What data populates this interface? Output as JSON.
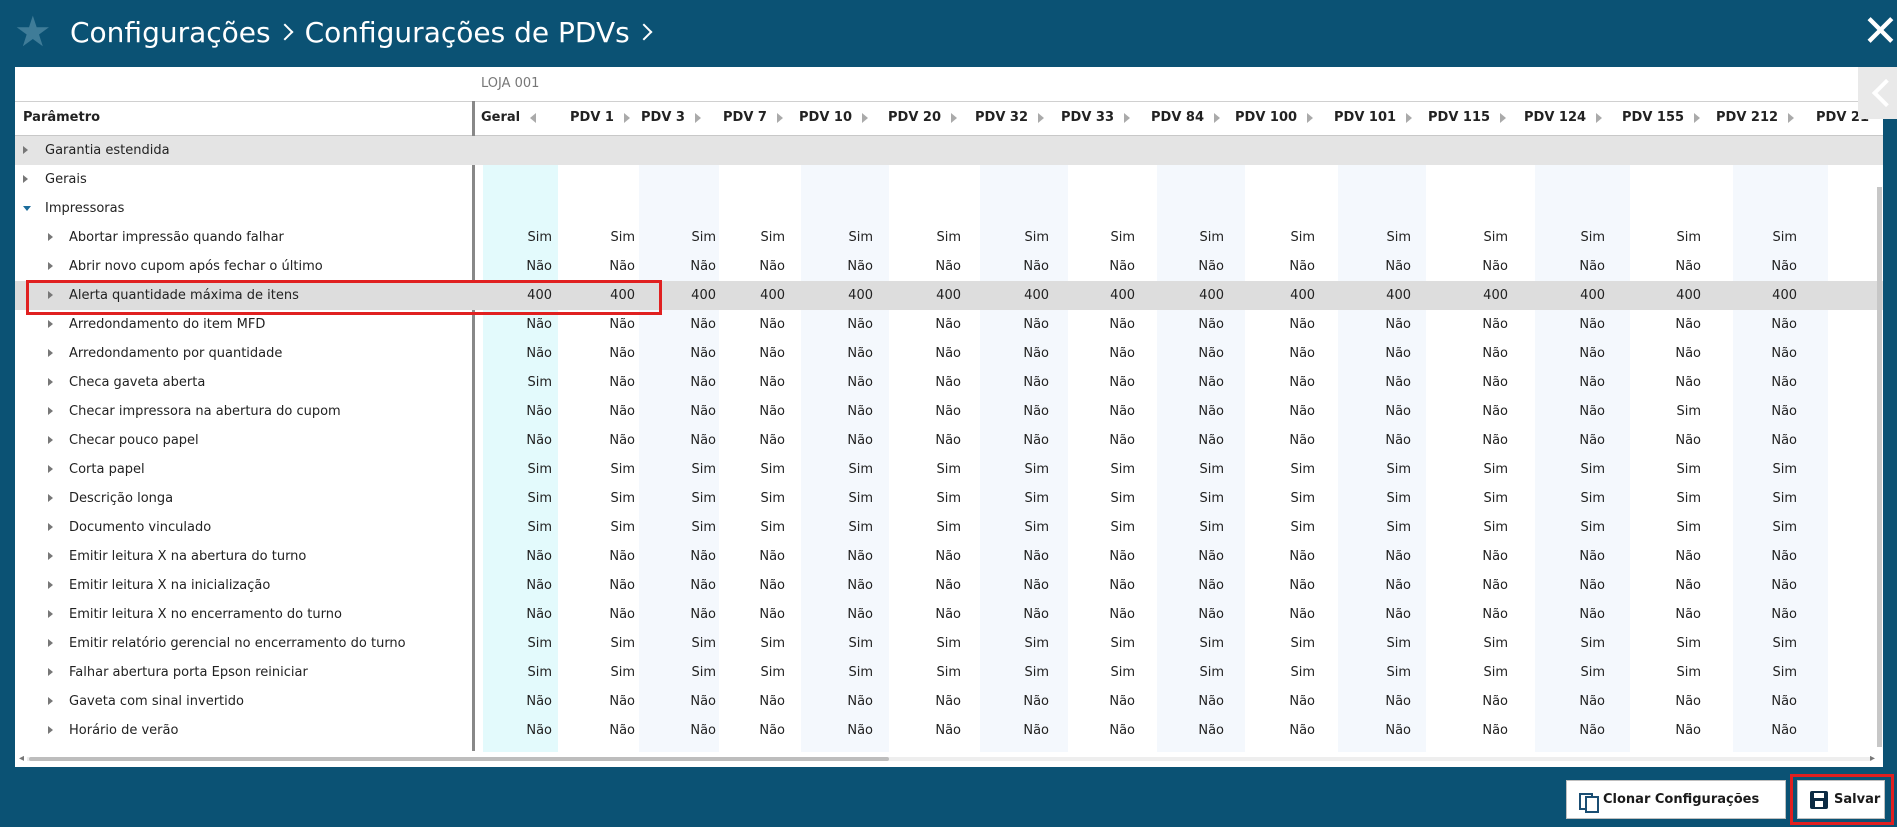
{
  "header": {
    "breadcrumbs": [
      "Configurações",
      "Configurações de PDVs"
    ]
  },
  "table": {
    "store_label": "LOJA 001",
    "param_header": "Parâmetro",
    "columns": [
      "Geral",
      "PDV 1",
      "PDV 3",
      "PDV 7",
      "PDV 10",
      "PDV 20",
      "PDV 32",
      "PDV 33",
      "PDV 84",
      "PDV 100",
      "PDV 101",
      "PDV 115",
      "PDV 124",
      "PDV 155",
      "PDV 212",
      "PDV 21"
    ],
    "groups": [
      {
        "label": "Garantia estendida"
      },
      {
        "label": "Gerais"
      },
      {
        "label": "Impressoras"
      }
    ],
    "rows": [
      {
        "label": "Abortar impressão quando falhar",
        "values": [
          "Sim",
          "Sim",
          "Sim",
          "Sim",
          "Sim",
          "Sim",
          "Sim",
          "Sim",
          "Sim",
          "Sim",
          "Sim",
          "Sim",
          "Sim",
          "Sim",
          "Sim"
        ]
      },
      {
        "label": "Abrir novo cupom após fechar o último",
        "values": [
          "Não",
          "Não",
          "Não",
          "Não",
          "Não",
          "Não",
          "Não",
          "Não",
          "Não",
          "Não",
          "Não",
          "Não",
          "Não",
          "Não",
          "Não"
        ]
      },
      {
        "label": "Alerta quantidade máxima de itens",
        "values": [
          "400",
          "400",
          "400",
          "400",
          "400",
          "400",
          "400",
          "400",
          "400",
          "400",
          "400",
          "400",
          "400",
          "400",
          "400"
        ]
      },
      {
        "label": "Arredondamento do item MFD",
        "values": [
          "Não",
          "Não",
          "Não",
          "Não",
          "Não",
          "Não",
          "Não",
          "Não",
          "Não",
          "Não",
          "Não",
          "Não",
          "Não",
          "Não",
          "Não"
        ]
      },
      {
        "label": "Arredondamento por quantidade",
        "values": [
          "Não",
          "Não",
          "Não",
          "Não",
          "Não",
          "Não",
          "Não",
          "Não",
          "Não",
          "Não",
          "Não",
          "Não",
          "Não",
          "Não",
          "Não"
        ]
      },
      {
        "label": "Checa gaveta aberta",
        "values": [
          "Sim",
          "Não",
          "Não",
          "Não",
          "Não",
          "Não",
          "Não",
          "Não",
          "Não",
          "Não",
          "Não",
          "Não",
          "Não",
          "Não",
          "Não"
        ]
      },
      {
        "label": "Checar impressora na abertura do cupom",
        "values": [
          "Não",
          "Não",
          "Não",
          "Não",
          "Não",
          "Não",
          "Não",
          "Não",
          "Não",
          "Não",
          "Não",
          "Não",
          "Não",
          "Sim",
          "Não"
        ]
      },
      {
        "label": "Checar pouco papel",
        "values": [
          "Não",
          "Não",
          "Não",
          "Não",
          "Não",
          "Não",
          "Não",
          "Não",
          "Não",
          "Não",
          "Não",
          "Não",
          "Não",
          "Não",
          "Não"
        ]
      },
      {
        "label": "Corta papel",
        "values": [
          "Sim",
          "Sim",
          "Sim",
          "Sim",
          "Sim",
          "Sim",
          "Sim",
          "Sim",
          "Sim",
          "Sim",
          "Sim",
          "Sim",
          "Sim",
          "Sim",
          "Sim"
        ]
      },
      {
        "label": "Descrição longa",
        "values": [
          "Sim",
          "Sim",
          "Sim",
          "Sim",
          "Sim",
          "Sim",
          "Sim",
          "Sim",
          "Sim",
          "Sim",
          "Sim",
          "Sim",
          "Sim",
          "Sim",
          "Sim"
        ]
      },
      {
        "label": "Documento vinculado",
        "values": [
          "Sim",
          "Sim",
          "Sim",
          "Sim",
          "Sim",
          "Sim",
          "Sim",
          "Sim",
          "Sim",
          "Sim",
          "Sim",
          "Sim",
          "Sim",
          "Sim",
          "Sim"
        ]
      },
      {
        "label": "Emitir leitura X na abertura do turno",
        "values": [
          "Não",
          "Não",
          "Não",
          "Não",
          "Não",
          "Não",
          "Não",
          "Não",
          "Não",
          "Não",
          "Não",
          "Não",
          "Não",
          "Não",
          "Não"
        ]
      },
      {
        "label": "Emitir leitura X na inicialização",
        "values": [
          "Não",
          "Não",
          "Não",
          "Não",
          "Não",
          "Não",
          "Não",
          "Não",
          "Não",
          "Não",
          "Não",
          "Não",
          "Não",
          "Não",
          "Não"
        ]
      },
      {
        "label": "Emitir leitura X no encerramento do turno",
        "values": [
          "Não",
          "Não",
          "Não",
          "Não",
          "Não",
          "Não",
          "Não",
          "Não",
          "Não",
          "Não",
          "Não",
          "Não",
          "Não",
          "Não",
          "Não"
        ]
      },
      {
        "label": "Emitir relatório gerencial no encerramento do turno",
        "values": [
          "Sim",
          "Sim",
          "Sim",
          "Sim",
          "Sim",
          "Sim",
          "Sim",
          "Sim",
          "Sim",
          "Sim",
          "Sim",
          "Sim",
          "Sim",
          "Sim",
          "Sim"
        ]
      },
      {
        "label": "Falhar abertura porta Epson reiniciar",
        "values": [
          "Sim",
          "Sim",
          "Sim",
          "Sim",
          "Sim",
          "Sim",
          "Sim",
          "Sim",
          "Sim",
          "Sim",
          "Sim",
          "Sim",
          "Sim",
          "Sim",
          "Sim"
        ]
      },
      {
        "label": "Gaveta com sinal invertido",
        "values": [
          "Não",
          "Não",
          "Não",
          "Não",
          "Não",
          "Não",
          "Não",
          "Não",
          "Não",
          "Não",
          "Não",
          "Não",
          "Não",
          "Não",
          "Não"
        ]
      },
      {
        "label": "Horário de verão",
        "values": [
          "Não",
          "Não",
          "Não",
          "Não",
          "Não",
          "Não",
          "Não",
          "Não",
          "Não",
          "Não",
          "Não",
          "Não",
          "Não",
          "Não",
          "Não"
        ]
      }
    ]
  },
  "footer": {
    "clone_label": "Clonar Configurações",
    "save_label": "Salvar"
  },
  "colors": {
    "background": "#0b5274",
    "highlight": "#e02020",
    "geral_column": "#e3fafc"
  }
}
